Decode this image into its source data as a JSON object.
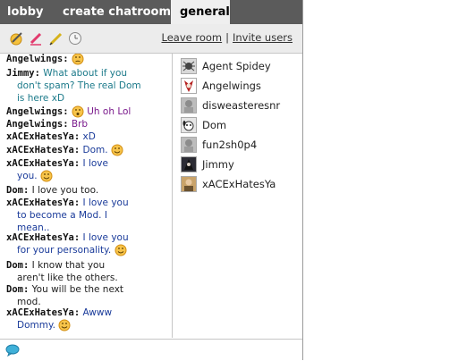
{
  "tabs": [
    {
      "label": "lobby"
    },
    {
      "label": "create chatroom"
    },
    {
      "label": "general"
    }
  ],
  "toolbar": {
    "leave_label": "Leave room",
    "separator": "|",
    "invite_label": "Invite users"
  },
  "messages": [
    {
      "nick": "Angelwings:",
      "text": ""
    },
    {
      "nick": "Jimmy:",
      "text": "What about if you",
      "cont1": "don't spam? The real Dom",
      "cont2": "is here xD"
    },
    {
      "nick": "Angelwings:",
      "text": "Uh oh Lol"
    },
    {
      "nick": "Angelwings:",
      "text": "Brb"
    },
    {
      "nick": "xACExHatesYa:",
      "text": "xD"
    },
    {
      "nick": "xACExHatesYa:",
      "text": "Dom."
    },
    {
      "nick": "xACExHatesYa:",
      "text": "I love",
      "cont1": "you."
    },
    {
      "nick": "Dom:",
      "text": "I love you too."
    },
    {
      "nick": "xACExHatesYa:",
      "text": "I love you",
      "cont1": "to become a Mod. I",
      "cont2": "mean.."
    },
    {
      "nick": "xACExHatesYa:",
      "text": "I love you",
      "cont1": "for your personality."
    },
    {
      "nick": "Dom:",
      "text": "I know that you",
      "cont1": "aren't like the others."
    },
    {
      "nick": "Dom:",
      "text": "You will be the next",
      "cont1": "mod."
    },
    {
      "nick": "xACExHatesYa:",
      "text": "Awww",
      "cont1": "Dommy."
    }
  ],
  "users": [
    {
      "name": "Agent Spidey",
      "avatar": "spider-avatar"
    },
    {
      "name": "Angelwings",
      "avatar": "harley-avatar"
    },
    {
      "name": "disweasteresnr",
      "avatar": "gray-avatar"
    },
    {
      "name": "Dom",
      "avatar": "dog-avatar"
    },
    {
      "name": "fun2sh0p4",
      "avatar": "gray-avatar"
    },
    {
      "name": "Jimmy",
      "avatar": "dark-avatar"
    },
    {
      "name": "xACExHatesYa",
      "avatar": "photo-avatar"
    }
  ],
  "input": {
    "placeholder": ""
  },
  "colors": {
    "tabbar": "#5b5b5b",
    "toolbar": "#ececec",
    "teal": "#1c7a8a",
    "purple": "#7a1a8c",
    "navy": "#1a3b9a"
  }
}
